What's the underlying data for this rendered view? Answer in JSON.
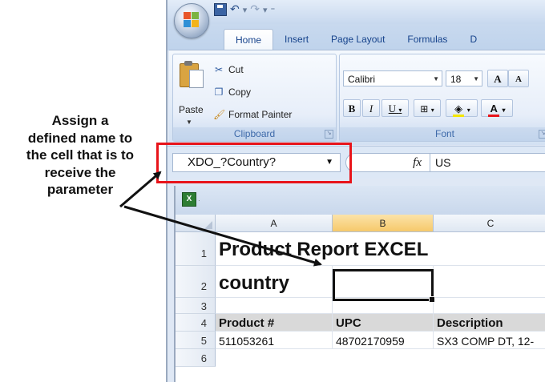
{
  "callout": {
    "lines": [
      "Assign a",
      "defined name to",
      "the cell that is to",
      "receive the",
      "parameter"
    ]
  },
  "ribbon": {
    "tabs": [
      "Home",
      "Insert",
      "Page Layout",
      "Formulas",
      "D"
    ],
    "clipboard": {
      "paste_label": "Paste",
      "cut_label": "Cut",
      "copy_label": "Copy",
      "format_painter_label": "Format Painter",
      "group_label": "Clipboard"
    },
    "font": {
      "font_name": "Calibri",
      "font_size": "18",
      "group_label": "Font",
      "bold": "B",
      "italic": "I",
      "underline": "U",
      "grow": "A",
      "shrink": "A",
      "font_color": "A"
    }
  },
  "formula_bar": {
    "name_box": "XDO_?Country?",
    "fx": "fx",
    "value": "US"
  },
  "sheet": {
    "columns": [
      "A",
      "B",
      "C"
    ],
    "rows": [
      {
        "num": "1",
        "A": "Product Report EXCEL",
        "B": "",
        "C": ""
      },
      {
        "num": "2",
        "A": "country",
        "B": "",
        "C": ""
      },
      {
        "num": "3",
        "A": "",
        "B": "",
        "C": ""
      },
      {
        "num": "4",
        "A": "Product #",
        "B": "UPC",
        "C": "Description"
      },
      {
        "num": "5",
        "A": "511053261",
        "B": "48702170959",
        "C": "SX3 COMP DT, 12-"
      },
      {
        "num": "6",
        "A": "",
        "B": "",
        "C": ""
      }
    ]
  },
  "colors": {
    "highlight_box": "#e8141a",
    "header_fill": "#d9d9d9",
    "selected_column": "#f6c96b"
  }
}
